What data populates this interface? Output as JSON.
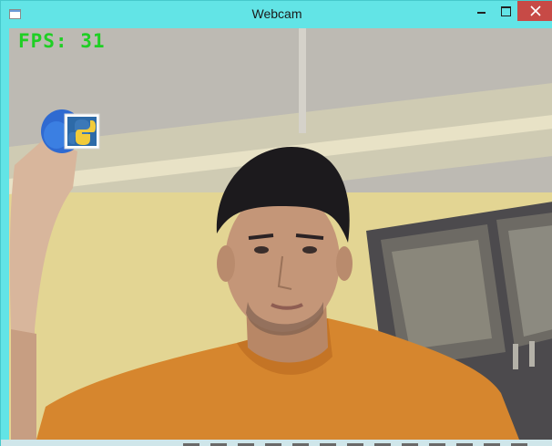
{
  "window": {
    "title": "Webcam",
    "controls": {
      "minimize_icon": "minimize-icon",
      "maximize_icon": "maximize-icon",
      "close_icon": "close-icon"
    }
  },
  "overlay": {
    "fps_text": "FPS: 31"
  },
  "colors": {
    "titlebar": "#62e4e6",
    "fps_text": "#1fcf24",
    "close_button": "#c74a46"
  }
}
